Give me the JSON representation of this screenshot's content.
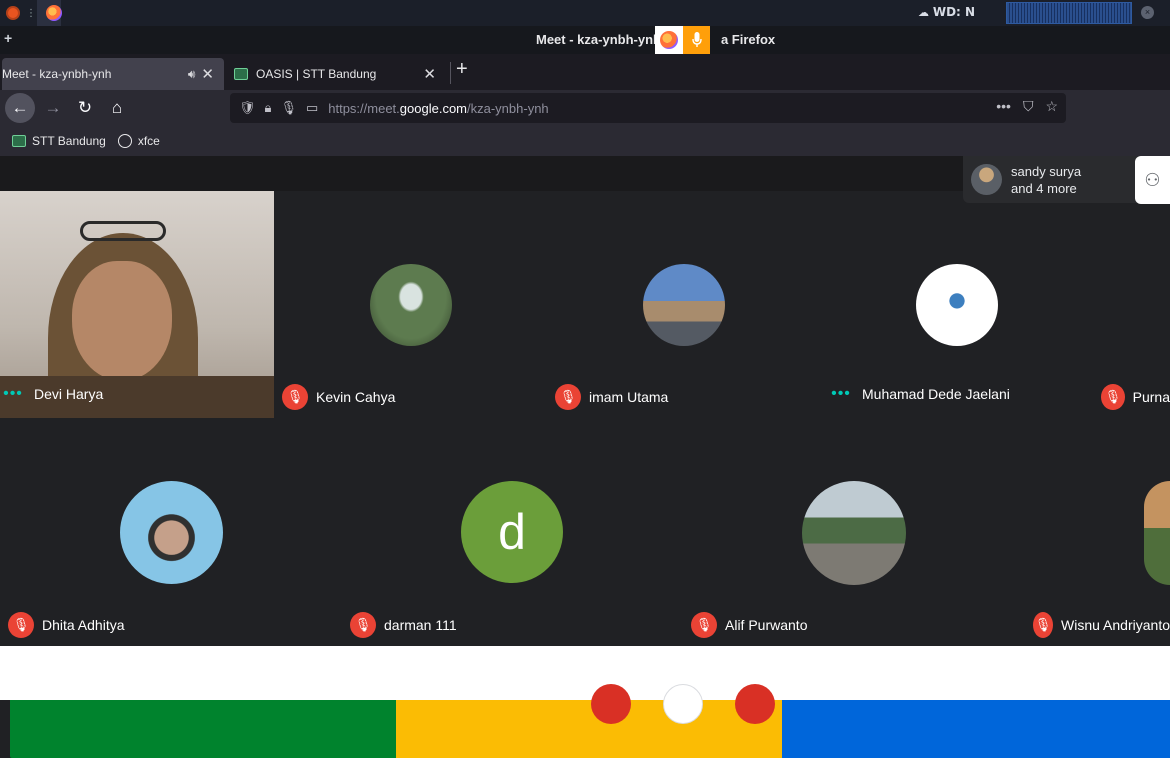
{
  "os_panel": {
    "weather_text": "WD: N"
  },
  "window": {
    "title": "Meet - kza-ynbh-ynh — Mozilla Firefox",
    "title_visible": "Meet - kza-ynbh-ynh",
    "title_visible_tail": "a Firefox"
  },
  "tabs": [
    {
      "label": "Meet - kza-ynbh-ynh",
      "active": true,
      "audio": true
    },
    {
      "label": "OASIS | STT Bandung",
      "active": false
    }
  ],
  "url": {
    "prefix": "https://meet.",
    "domain": "google.com",
    "path": "/kza-ynbh-ynh"
  },
  "bookmarks": [
    {
      "label": "STT Bandung",
      "icon": "oasis-favicon"
    },
    {
      "label": "xfce",
      "icon": "globe-icon"
    }
  ],
  "people_panel": {
    "line1": "sandy surya",
    "line2": "and 4 more"
  },
  "participants": [
    {
      "name": "Devi Harya",
      "status": "speaking"
    },
    {
      "name": "Kevin Cahya",
      "status": "muted"
    },
    {
      "name": "imam Utama",
      "status": "muted"
    },
    {
      "name": "Muhamad Dede Jaelani",
      "status": "speaking"
    },
    {
      "name": "Purna",
      "status": "muted"
    },
    {
      "name": "Dhita Adhitya",
      "status": "muted"
    },
    {
      "name": "darman 111",
      "status": "muted",
      "initial": "d"
    },
    {
      "name": "Alif Purwanto",
      "status": "muted"
    },
    {
      "name": "Wisnu Andriyanto",
      "status": "muted"
    }
  ],
  "colors": {
    "mute_red": "#ea4335",
    "meet_bg": "#202124",
    "darman_avatar": "#6b9e3a"
  }
}
